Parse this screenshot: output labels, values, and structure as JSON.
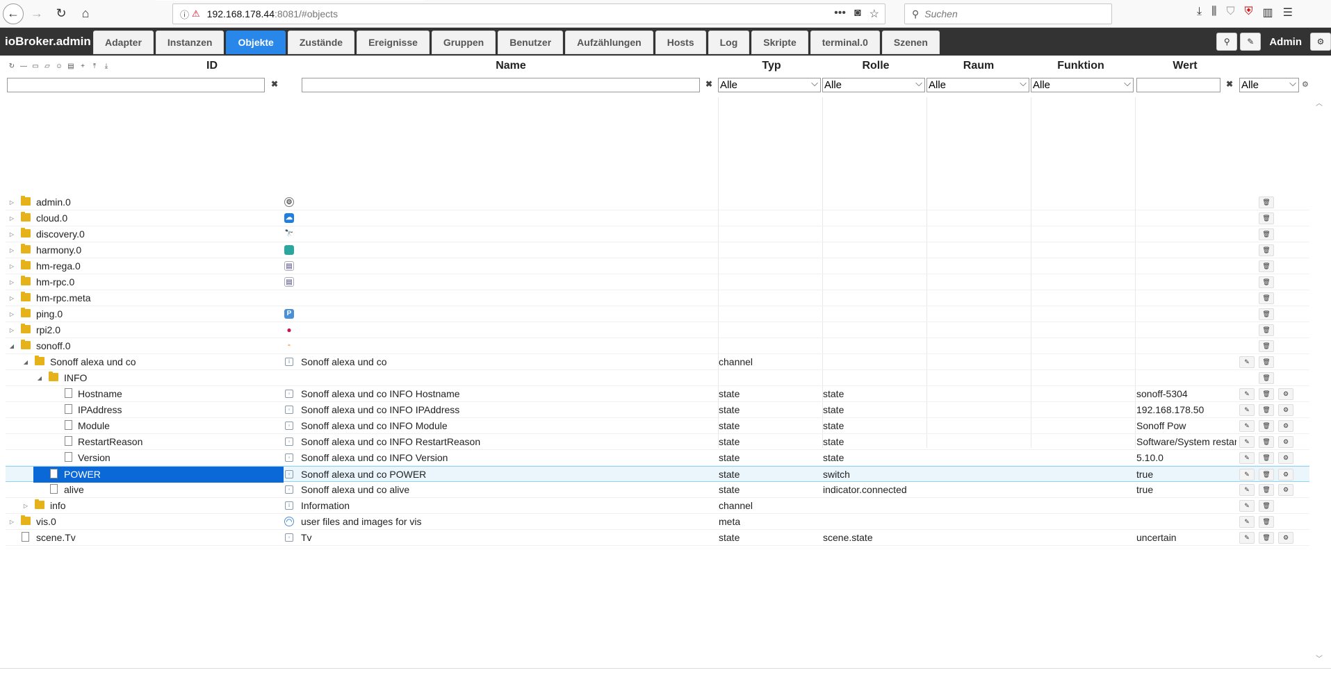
{
  "browser": {
    "url_host": "192.168.178.44",
    "url_rest": ":8081/#objects",
    "search_placeholder": "Suchen"
  },
  "app": {
    "title": "ioBroker.admin",
    "tabs": [
      "Adapter",
      "Instanzen",
      "Objekte",
      "Zustände",
      "Ereignisse",
      "Gruppen",
      "Benutzer",
      "Aufzählungen",
      "Hosts",
      "Log",
      "Skripte",
      "terminal.0",
      "Szenen"
    ],
    "active_tab": "Objekte",
    "user": "Admin"
  },
  "columns": {
    "id": "ID",
    "name": "Name",
    "typ": "Typ",
    "rolle": "Rolle",
    "raum": "Raum",
    "funktion": "Funktion",
    "wert": "Wert"
  },
  "filters": {
    "typ": "Alle",
    "rolle": "Alle",
    "raum": "Alle",
    "funktion": "Alle",
    "wert_select": "Alle"
  },
  "rows": [
    {
      "id": "admin.0",
      "name": "",
      "typ": "",
      "rolle": "",
      "wert": ""
    },
    {
      "id": "cloud.0",
      "name": "",
      "typ": "",
      "rolle": "",
      "wert": ""
    },
    {
      "id": "discovery.0",
      "name": "",
      "typ": "",
      "rolle": "",
      "wert": ""
    },
    {
      "id": "harmony.0",
      "name": "",
      "typ": "",
      "rolle": "",
      "wert": ""
    },
    {
      "id": "hm-rega.0",
      "name": "",
      "typ": "",
      "rolle": "",
      "wert": ""
    },
    {
      "id": "hm-rpc.0",
      "name": "",
      "typ": "",
      "rolle": "",
      "wert": ""
    },
    {
      "id": "hm-rpc.meta",
      "name": "",
      "typ": "",
      "rolle": "",
      "wert": ""
    },
    {
      "id": "ping.0",
      "name": "",
      "typ": "",
      "rolle": "",
      "wert": ""
    },
    {
      "id": "rpi2.0",
      "name": "",
      "typ": "",
      "rolle": "",
      "wert": ""
    },
    {
      "id": "sonoff.0",
      "name": "",
      "typ": "",
      "rolle": "",
      "wert": ""
    },
    {
      "id": "Sonoff alexa und co",
      "name": "Sonoff alexa und co",
      "typ": "channel",
      "rolle": "",
      "wert": ""
    },
    {
      "id": "INFO",
      "name": "",
      "typ": "",
      "rolle": "",
      "wert": ""
    },
    {
      "id": "Hostname",
      "name": "Sonoff alexa und co INFO Hostname",
      "typ": "state",
      "rolle": "state",
      "wert": "sonoff-5304"
    },
    {
      "id": "IPAddress",
      "name": "Sonoff alexa und co INFO IPAddress",
      "typ": "state",
      "rolle": "state",
      "wert": "192.168.178.50"
    },
    {
      "id": "Module",
      "name": "Sonoff alexa und co INFO Module",
      "typ": "state",
      "rolle": "state",
      "wert": "Sonoff Pow"
    },
    {
      "id": "RestartReason",
      "name": "Sonoff alexa und co INFO RestartReason",
      "typ": "state",
      "rolle": "state",
      "wert": "Software/System restart"
    },
    {
      "id": "Version",
      "name": "Sonoff alexa und co INFO Version",
      "typ": "state",
      "rolle": "state",
      "wert": "5.10.0"
    },
    {
      "id": "POWER",
      "name": "Sonoff alexa und co POWER",
      "typ": "state",
      "rolle": "switch",
      "wert": "true"
    },
    {
      "id": "alive",
      "name": "Sonoff alexa und co alive",
      "typ": "state",
      "rolle": "indicator.connected",
      "wert": "true"
    },
    {
      "id": "info",
      "name": "Information",
      "typ": "channel",
      "rolle": "",
      "wert": ""
    },
    {
      "id": "vis.0",
      "name": "user files and images for vis",
      "typ": "meta",
      "rolle": "",
      "wert": ""
    },
    {
      "id": "scene.Tv",
      "name": "Tv",
      "typ": "state",
      "rolle": "scene.state",
      "wert": "uncertain"
    }
  ]
}
